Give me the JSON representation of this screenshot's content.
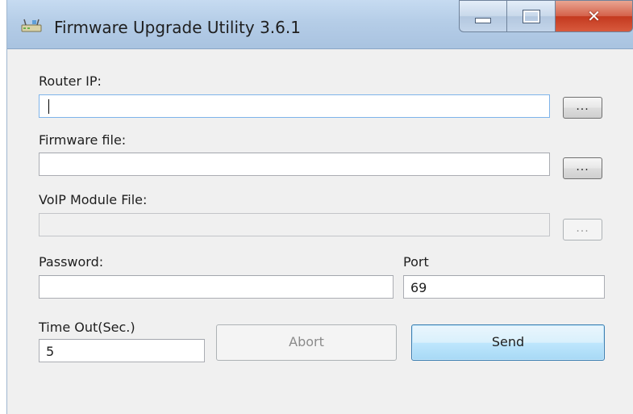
{
  "window": {
    "title": "Firmware Upgrade Utility 3.6.1",
    "icon": "router-app-icon",
    "controls": {
      "minimize": "minimize-icon",
      "maximize": "maximize-icon",
      "close": "close-icon"
    }
  },
  "form": {
    "router_ip": {
      "label": "Router IP:",
      "value": "",
      "browse_label": "..."
    },
    "firmware_file": {
      "label": "Firmware file:",
      "value": "",
      "browse_label": "..."
    },
    "voip_module_file": {
      "label": "VoIP Module File:",
      "value": "",
      "browse_label": "..."
    },
    "password": {
      "label": "Password:",
      "value": ""
    },
    "port": {
      "label": "Port",
      "value": "69"
    },
    "timeout": {
      "label": "Time Out(Sec.)",
      "value": "5"
    }
  },
  "buttons": {
    "abort": "Abort",
    "send": "Send"
  },
  "colors": {
    "titlebar": "#b5cde7",
    "close_button": "#c4391f",
    "send_border": "#3c7fb1"
  }
}
